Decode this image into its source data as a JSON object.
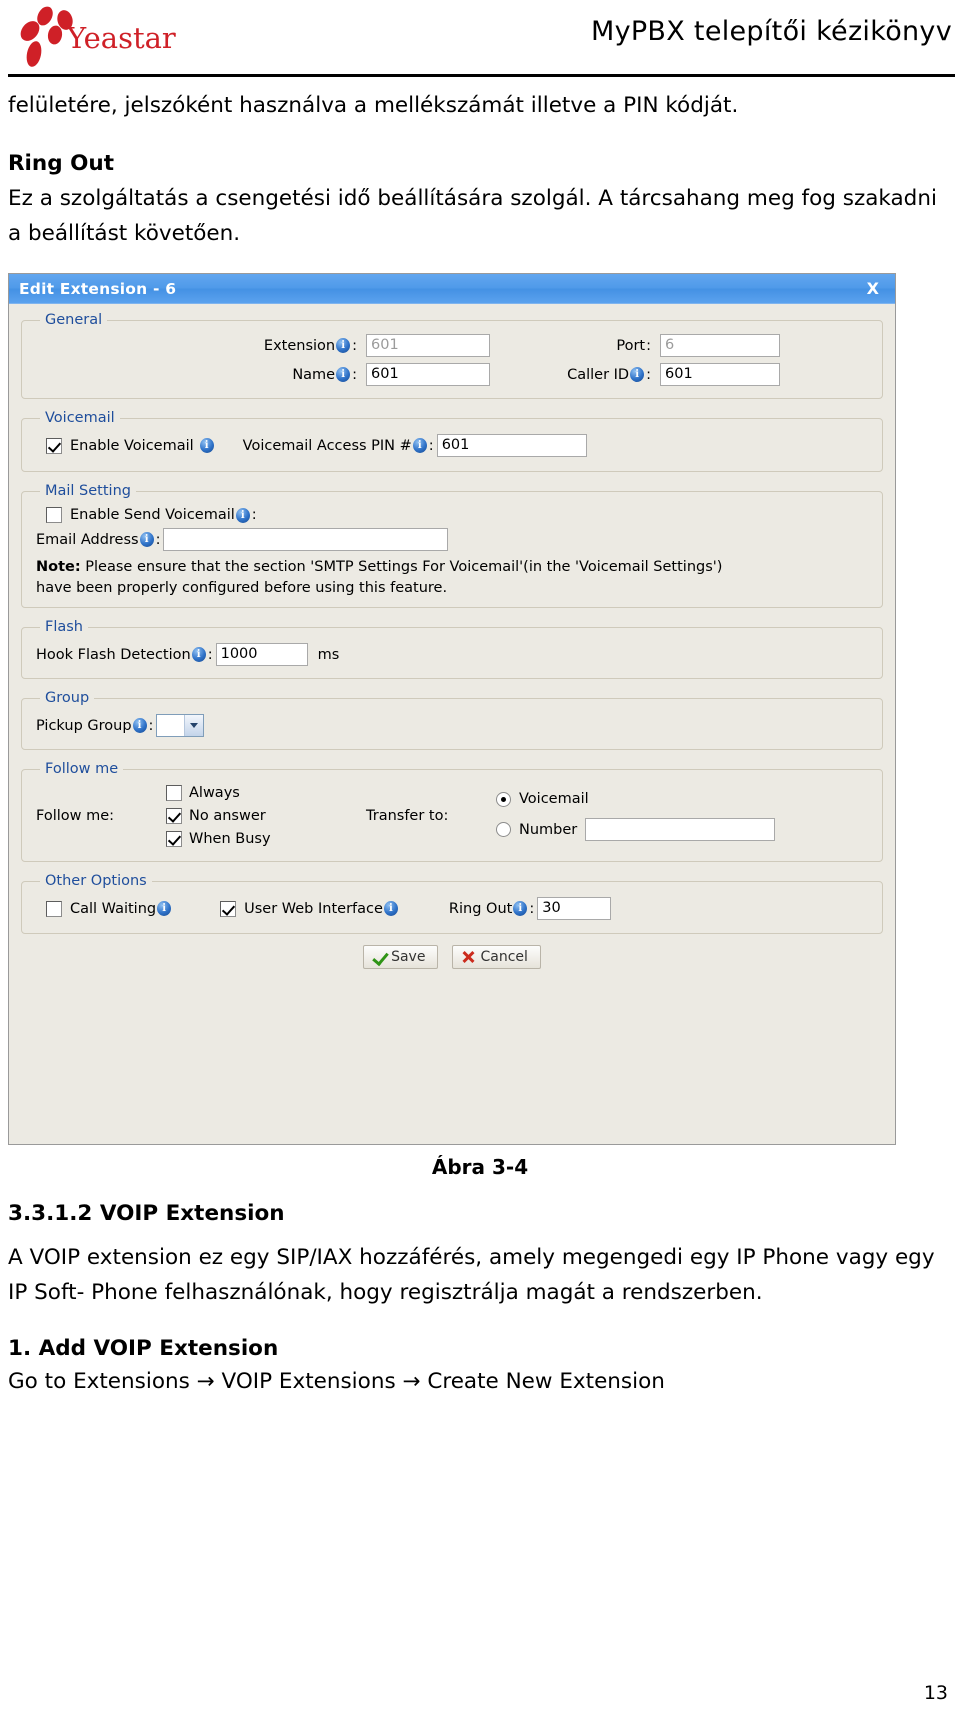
{
  "header": {
    "logo_text": "Yeastar",
    "manual_title": "MyPBX telepítői kézikönyv"
  },
  "intro": {
    "line1": "felületére, jelszóként használva a mellékszámát illetve a PIN kódját.",
    "ring_out_heading": "Ring Out",
    "ring_out_text": "Ez a szolgáltatás a csengetési idő beállítására szolgál. A tárcsahang meg fog szakadni a beállítást követően."
  },
  "dialog": {
    "title": "Edit Extension - 6",
    "close_label": "X",
    "general": {
      "legend": "General",
      "extension_label": "Extension",
      "extension_value": "601",
      "port_label": "Port",
      "port_value": "6",
      "name_label": "Name",
      "name_value": "601",
      "callerid_label": "Caller ID",
      "callerid_value": "601"
    },
    "voicemail": {
      "legend": "Voicemail",
      "enable_label": "Enable Voicemail",
      "enable_checked": true,
      "pin_label": "Voicemail Access PIN #",
      "pin_value": "601"
    },
    "mail_setting": {
      "legend": "Mail Setting",
      "enable_send_label": "Enable Send Voicemail",
      "enable_send_checked": false,
      "email_label": "Email Address",
      "email_value": "",
      "note_bold": "Note:",
      "note_line1": " Please ensure that the section 'SMTP Settings For Voicemail'(in the 'Voicemail Settings')",
      "note_line2": "have been properly configured before using this feature."
    },
    "flash": {
      "legend": "Flash",
      "hook_label": "Hook Flash Detection",
      "hook_value": "1000",
      "unit": "ms"
    },
    "group": {
      "legend": "Group",
      "pickup_label": "Pickup Group",
      "pickup_value": ""
    },
    "follow_me": {
      "legend": "Follow me",
      "row_label": "Follow me:",
      "always_label": "Always",
      "always_checked": false,
      "noanswer_label": "No answer",
      "noanswer_checked": true,
      "whenbusy_label": "When Busy",
      "whenbusy_checked": true,
      "transfer_label": "Transfer to:",
      "voicemail_label": "Voicemail",
      "voicemail_selected": true,
      "number_label": "Number",
      "number_selected": false,
      "number_value": ""
    },
    "other_options": {
      "legend": "Other Options",
      "call_waiting_label": "Call Waiting",
      "call_waiting_checked": false,
      "user_web_label": "User Web Interface",
      "user_web_checked": true,
      "ring_out_label": "Ring Out",
      "ring_out_value": "30"
    },
    "buttons": {
      "save": "Save",
      "cancel": "Cancel"
    }
  },
  "figure_caption": "Ábra 3-4",
  "section": {
    "number_title": "3.3.1.2 VOIP Extension",
    "paragraph": "A VOIP extension ez egy SIP/IAX hozzáférés, amely megengedi egy IP Phone vagy egy IP Soft- Phone felhasználónak, hogy regisztrálja magát a rendszerben.",
    "step_title": "1. Add VOIP Extension",
    "step_line": "Go to Extensions → VOIP Extensions → Create New Extension"
  },
  "page_number": "13",
  "colors": {
    "titlebar_blue": "#4f9ae9",
    "legend_blue": "#1f4e9c",
    "page_bg": "#ffffff",
    "dialog_bg": "#eceae3"
  }
}
